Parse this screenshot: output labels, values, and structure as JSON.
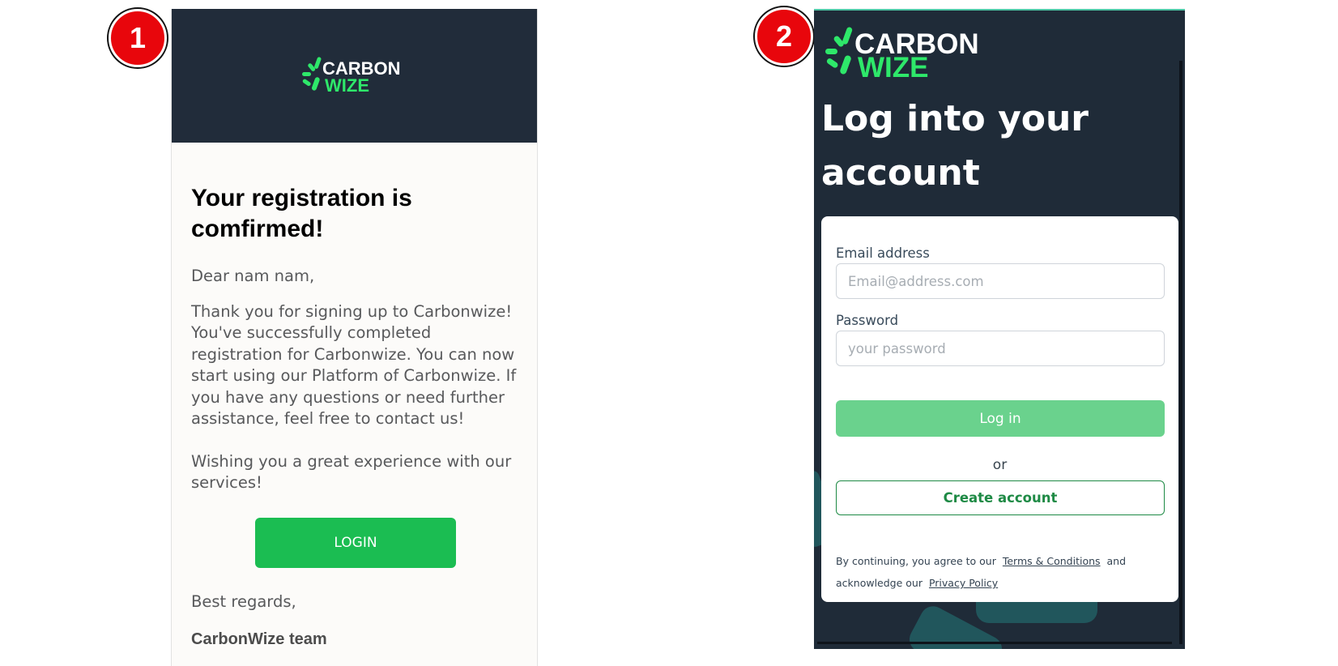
{
  "badges": [
    "1",
    "2"
  ],
  "brand": {
    "line1": "CARBON",
    "line2": "WIZE",
    "white": "#ffffff",
    "green": "#2ee86a",
    "header_bg": "#212c3a"
  },
  "email": {
    "title": "Your registration is comfirmed!",
    "greeting": "Dear nam nam,",
    "body": "Thank you for signing up to Carbonwize! You've successfully completed registration for Carbonwize. You can now start using our Platform of Carbonwize. If you have any questions or need further assistance, feel free to contact us!",
    "wish": "Wishing you a great experience with our services!",
    "login_button": "LOGIN",
    "signoff": "Best regards,",
    "team": "CarbonWize team",
    "button_color": "#1bbd52"
  },
  "login": {
    "heading": "Log into your account",
    "email_label": "Email address",
    "email_placeholder": "Email@address.com",
    "password_label": "Password",
    "password_placeholder": "your password",
    "login_button": "Log in",
    "or": "or",
    "create_account": "Create account",
    "legal_prefix": "By continuing, you agree to our",
    "terms_link": "Terms & Conditions",
    "legal_middle": "and acknowledge our",
    "privacy_link": "Privacy Policy",
    "button_color": "#6ad28d",
    "outline_color": "#1e8a45"
  }
}
